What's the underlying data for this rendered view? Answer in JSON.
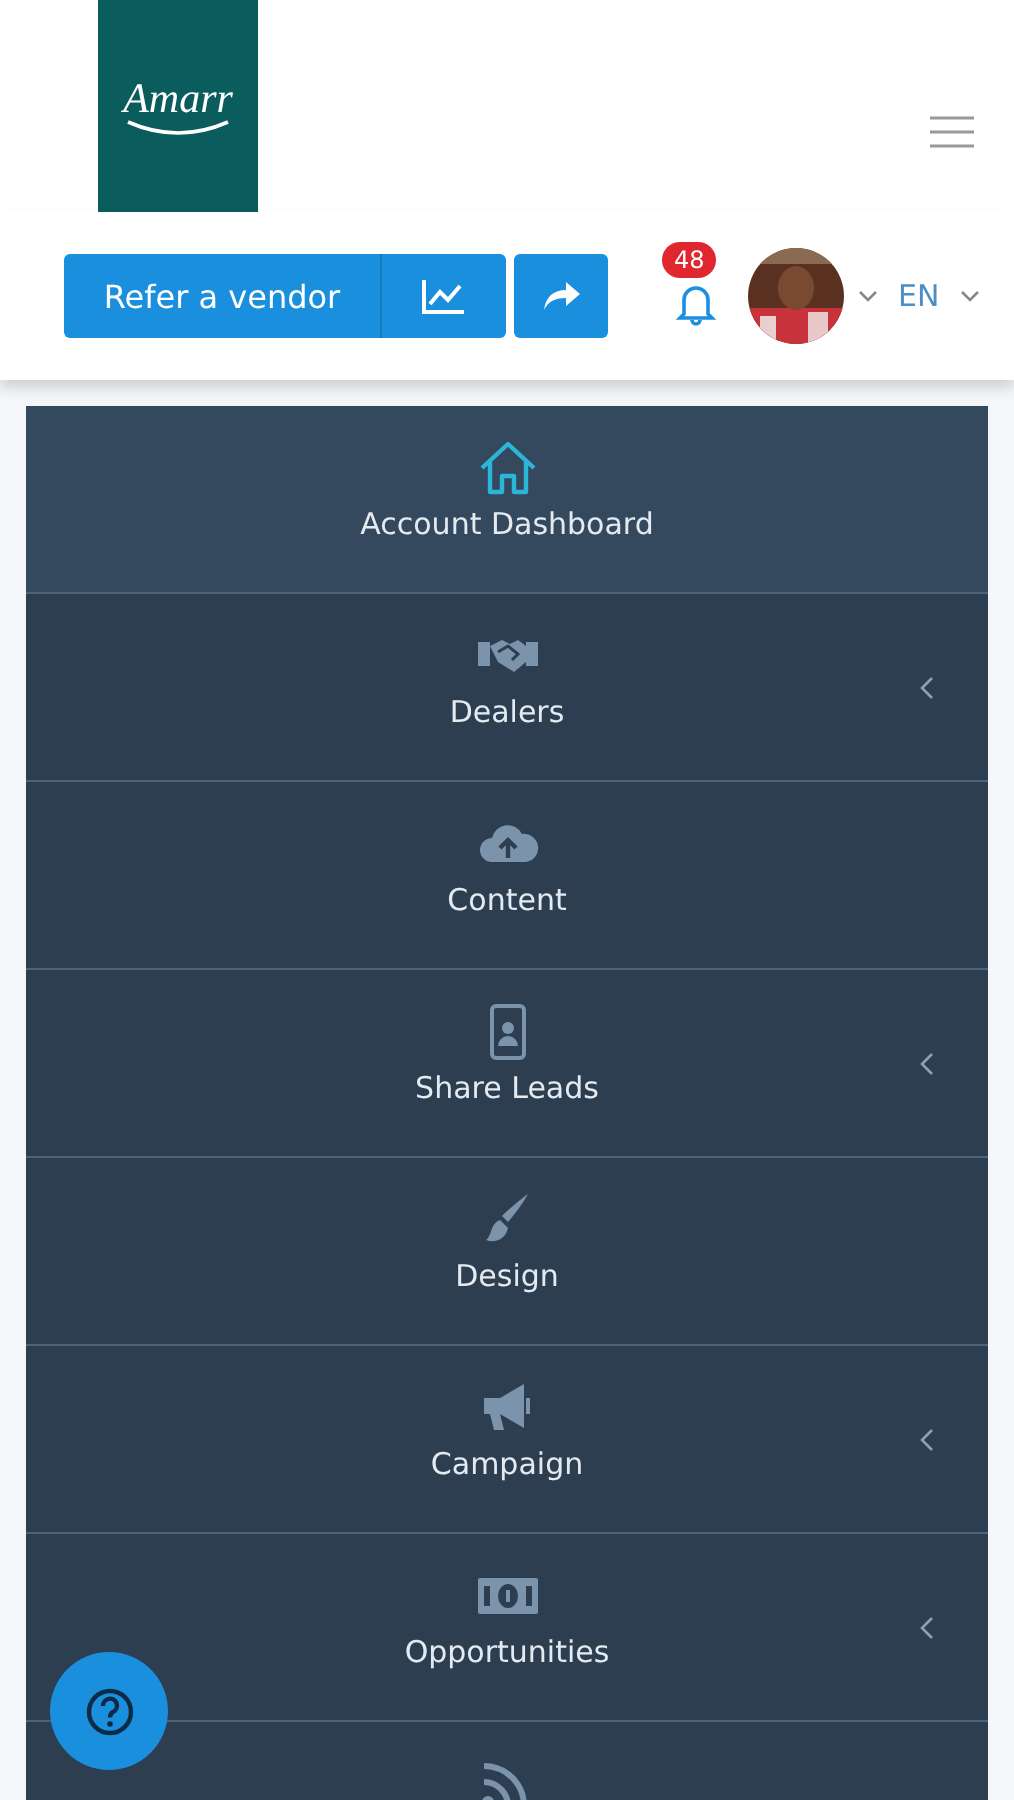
{
  "logo": {
    "text": "Amarr"
  },
  "toolbar": {
    "refer_button": "Refer a vendor",
    "notifications": {
      "count": "48"
    },
    "language": "EN"
  },
  "menu": [
    {
      "label": "Account Dashboard",
      "kind": "home",
      "selected": true,
      "expandable": false
    },
    {
      "label": "Dealers",
      "kind": "handshake",
      "selected": false,
      "expandable": true
    },
    {
      "label": "Content",
      "kind": "cloud",
      "selected": false,
      "expandable": false
    },
    {
      "label": "Share Leads",
      "kind": "badge",
      "selected": false,
      "expandable": true
    },
    {
      "label": "Design",
      "kind": "brush",
      "selected": false,
      "expandable": false
    },
    {
      "label": "Campaign",
      "kind": "megaphone",
      "selected": false,
      "expandable": true
    },
    {
      "label": "Opportunities",
      "kind": "money",
      "selected": false,
      "expandable": true
    },
    {
      "kind": "feed",
      "selected": false,
      "expandable": false
    }
  ]
}
